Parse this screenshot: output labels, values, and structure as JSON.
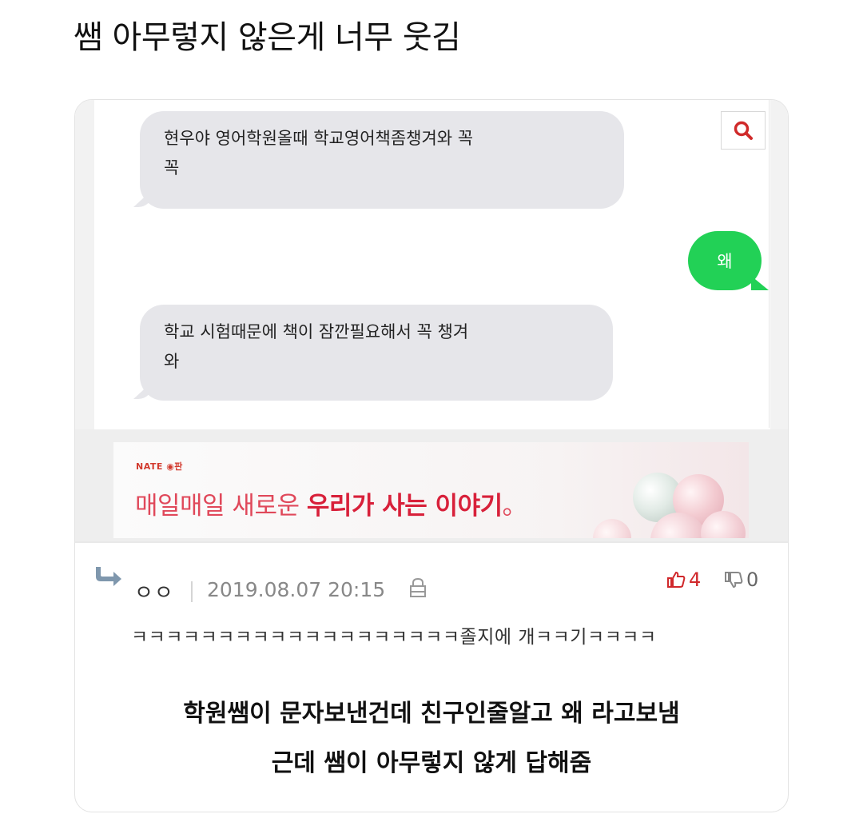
{
  "post": {
    "title": "쌤 아무렇지 않은게  너무 웃김"
  },
  "chat": {
    "messages": [
      {
        "side": "received",
        "text_line1": "현우야 영어학원올때 학교영어책좀챙겨와 꼭",
        "text_line2": "꼭"
      },
      {
        "side": "sent",
        "text": "왜"
      },
      {
        "side": "received",
        "text_line1": "학교 시험때문에 책이 잠깐필요해서 꼭 챙겨",
        "text_line2": "와"
      }
    ],
    "search_icon": "search-icon"
  },
  "banner": {
    "logo": "NATE ◉판",
    "text_light": "매일매일 새로운 ",
    "text_bold": "우리가 사는 이야기",
    "text_end": "。"
  },
  "comment": {
    "author": "ㅇㅇ",
    "date": "2019.08.07 20:15",
    "likes": "4",
    "dislikes": "0",
    "text": "ㅋㅋㅋㅋㅋㅋㅋㅋㅋㅋㅋㅋㅋㅋㅋㅋㅋㅋㅋ졸지에 개ㅋㅋ기ㅋㅋㅋㅋ"
  },
  "caption": {
    "line1": "학원쌤이 문자보낸건데 친구인줄알고 왜 라고보냄",
    "line2": "근데 쌤이 아무렇지 않게 답해줌"
  },
  "colors": {
    "sent_bubble": "#22d156",
    "received_bubble": "#e6e6ea",
    "banner_red": "#d8203a",
    "like_red": "#d0282b"
  }
}
